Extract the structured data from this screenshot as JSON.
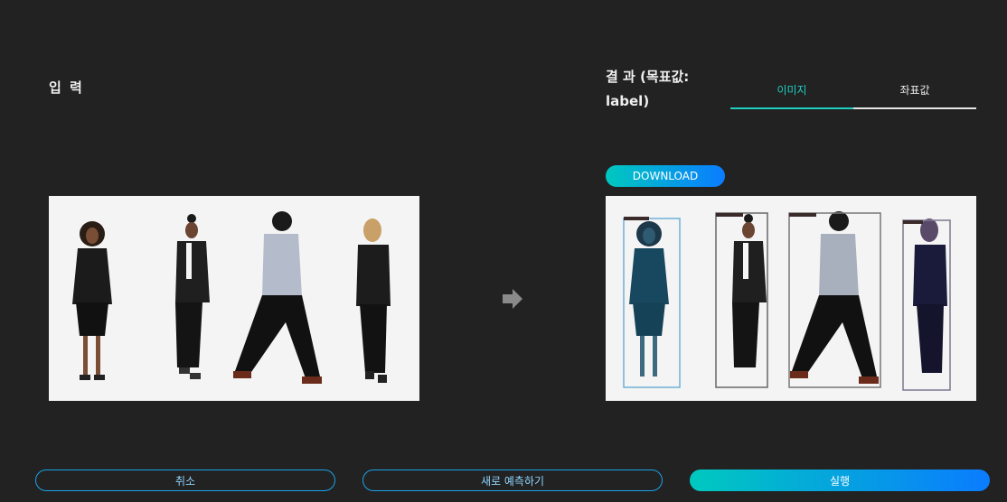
{
  "input": {
    "title": "입 력"
  },
  "result": {
    "title": "결 과 (목표값: label)"
  },
  "tabs": [
    {
      "label": "이미지",
      "active": true
    },
    {
      "label": "좌표값",
      "active": false
    }
  ],
  "download": {
    "label": "DOWNLOAD"
  },
  "buttons": {
    "cancel": "취소",
    "new_predict": "새로 예측하기",
    "run": "실행"
  },
  "colors": {
    "background": "#222222",
    "accent": "#1ecfc2",
    "gradient_start": "#00c9bf",
    "gradient_end": "#0a7cff"
  },
  "icons": {
    "arrow": "arrow-right-icon"
  }
}
